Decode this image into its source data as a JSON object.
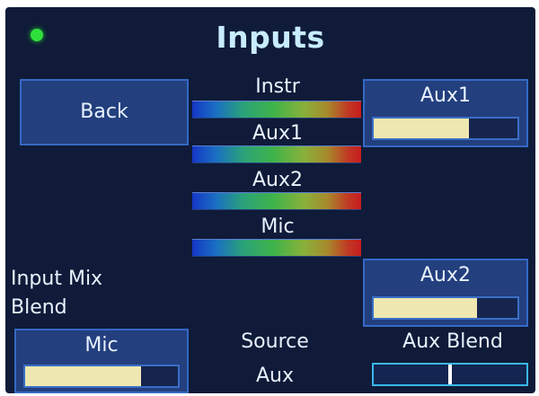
{
  "screen": {
    "title": "Inputs",
    "status_indicator_color": "#2fe03a"
  },
  "back_button": {
    "label": "Back"
  },
  "meters": [
    {
      "label": "Instr"
    },
    {
      "label": "Aux1"
    },
    {
      "label": "Aux2"
    },
    {
      "label": "Mic"
    }
  ],
  "aux1_panel": {
    "label": "Aux1",
    "level": 0.66
  },
  "aux2_panel": {
    "label": "Aux2",
    "level": 0.72
  },
  "mic_panel": {
    "label": "Mic",
    "level": 0.76
  },
  "input_mix_blend": {
    "line1": "Input Mix",
    "line2": "Blend"
  },
  "source": {
    "label": "Source",
    "value": "Aux"
  },
  "aux_blend": {
    "label": "Aux Blend",
    "level": 0.5
  },
  "colors": {
    "background": "#0f1b38",
    "panel": "#233f7e",
    "panel_border": "#3569c4",
    "level_fill": "#efe7b0",
    "title_text": "#c8ecff"
  }
}
